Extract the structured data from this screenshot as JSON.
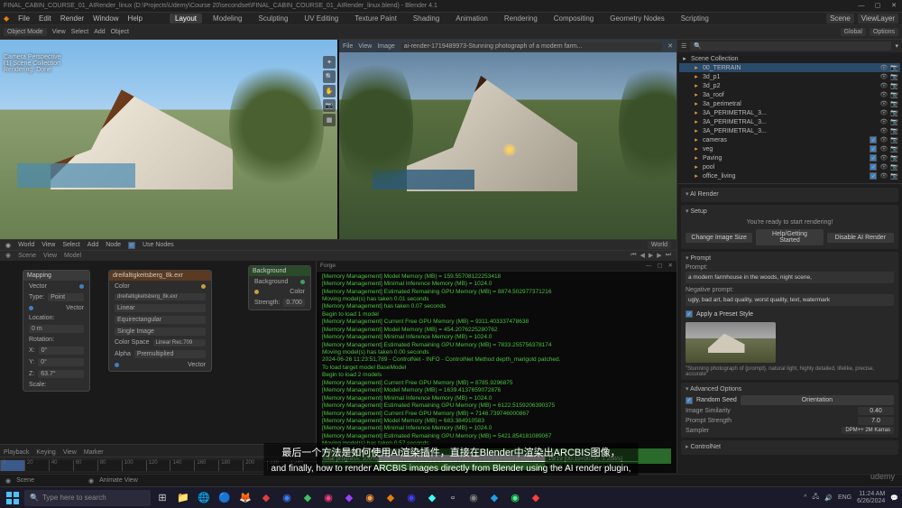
{
  "titlebar": {
    "title": "FINAL_CABIN_COURSE_01_AIRender_linux (D:\\Projects\\Udemy\\Course 20\\secondset\\FINAL_CABIN_COURSE_01_AIRender_linux.blend) - Blender 4.1"
  },
  "menu": {
    "file": "File",
    "edit": "Edit",
    "render": "Render",
    "window": "Window",
    "help": "Help"
  },
  "workspaces": [
    "Layout",
    "Modeling",
    "Sculpting",
    "UV Editing",
    "Texture Paint",
    "Shading",
    "Animation",
    "Rendering",
    "Compositing",
    "Geometry Nodes",
    "Scripting"
  ],
  "active_ws": 0,
  "scene_label": "Scene",
  "viewlayer_label": "ViewLayer",
  "toolbar_left": {
    "mode": "Object Mode",
    "view": "View",
    "select": "Select",
    "add": "Add",
    "object": "Object"
  },
  "toolbar_right": [
    "Global",
    "Options"
  ],
  "viewport1": {
    "info_line1": "Camera Perspective",
    "info_line2": "(1) Scene Collection",
    "info_line3": "Rendering: Done"
  },
  "viewport2_header": {
    "file": "File",
    "view": "View",
    "image": "Image",
    "path": "ai-render-1719489973-Stunning photograph of a modern farm..."
  },
  "status1": {
    "items": [
      "World",
      "View",
      "Select",
      "Add",
      "Node",
      "Use Nodes"
    ],
    "world_label": "World"
  },
  "status2": {
    "items": [
      "Scene",
      "View",
      "Model"
    ]
  },
  "node_editor": {
    "header": {
      "world": "World",
      "view": "View",
      "select": "Select",
      "add": "Add",
      "node": "Node",
      "use_nodes": "Use Nodes"
    }
  },
  "nodes": {
    "mapping": {
      "title": "Mapping",
      "type": "Type:",
      "type_val": "Point",
      "vector": "Vector",
      "loc": "Location:",
      "locv": "0 m",
      "rot": "Rotation:",
      "rotx": "X:",
      "rotxv": "0°",
      "roty": "Y:",
      "rotyv": "0°",
      "rotz": "Z:",
      "rotzv": "63.7°",
      "scale": "Scale:"
    },
    "envtex": {
      "title": "dreifaltigkeitsberg_8k.exr",
      "color": "Color",
      "image": "dreifaltigkeitsberg_8k.exr",
      "linear": "Linear",
      "equirect": "Equirectangular",
      "single": "Single Image",
      "colorspace": "Color Space",
      "cs_val": "Linear Rec.709",
      "alpha": "Alpha",
      "alpha_val": "Premultiplied",
      "vector": "Vector"
    },
    "background": {
      "title": "Background",
      "bg": "Background",
      "color": "Color",
      "strength": "Strength:",
      "strength_val": "0.700"
    }
  },
  "timeline": {
    "playback": "Playback",
    "keying": "Keying",
    "view": "View",
    "marker": "Marker",
    "ticks": [
      "0",
      "20",
      "40",
      "60",
      "80",
      "100",
      "120",
      "140",
      "160",
      "180",
      "200",
      "220",
      "240"
    ]
  },
  "console": {
    "title": "Forge",
    "lines": [
      "[Memory Management] Model Memory (MB) = 159.55708122253418",
      "[Memory Management] Minimal Inference Memory (MB) = 1024.0",
      "[Memory Management] Estimated Remaining GPU Memory (MB) = 8874.502977371216",
      "Moving model(s) has taken 0.01 seconds",
      "[Memory Management] has taken 0.07 seconds",
      "Begin to load 1 model",
      "[Memory Management] Current Free GPU Memory (MB) = 9311.403337478638",
      "[Memory Management] Model Memory (MB) = 454.2076225280762",
      "[Memory Management] Minimal Inference Memory (MB) = 1024.0",
      "[Memory Management] Estimated Remaining GPU Memory (MB) = 7833.255756378174",
      "Moving model(s) has taken 0.00 seconds",
      "2024-06-26 11:23:51,789 - ControlNet - INFO - ControlNet Method depth_marigold patched.",
      "To load target model BaseModel",
      "Begin to load 2 models",
      "[Memory Management] Current Free GPU Memory (MB) = 8785.9296875",
      "[Memory Management] Model Memory (MB) = 1639.4137659072876",
      "[Memory Management] Minimal Inference Memory (MB) = 1024.0",
      "[Memory Management] Estimated Remaining GPU Memory (MB) = 6122.5159206390375",
      "[Memory Management] Current Free GPU Memory (MB) = 7146.739746000867",
      "[Memory Management] Model Memory (MB) = 683.384910583",
      "[Memory Management] Minimal Inference Memory (MB) = 1024.0",
      "[Memory Management] Estimated Remaining GPU Memory (MB) = 5421.854181089067",
      "Moving model(s) has taken 0.57 seconds",
      "Moving model(s) has taken 3.68 seconds",
      "Total progress: 100%|████████████████████████████████████████| 19/19 [00:15<00:00,  1.25it/s]",
      "Total progress: 100%|████████████████████████████████████████| 19/19 [00:15<00:00,  1.21it/s]"
    ]
  },
  "outliner": {
    "title": "Scene Collection",
    "items": [
      {
        "name": "00_TERRAIN",
        "depth": 1,
        "sel": true
      },
      {
        "name": "3d_p1",
        "depth": 1
      },
      {
        "name": "3d_p2",
        "depth": 1
      },
      {
        "name": "3a_roof",
        "depth": 1
      },
      {
        "name": "3a_perimetral",
        "depth": 1
      },
      {
        "name": "3A_PERIMETRAL_3...",
        "depth": 1
      },
      {
        "name": "3A_PERIMETRAL_3...",
        "depth": 1
      },
      {
        "name": "3A_PERIMETRAL_3...",
        "depth": 1
      },
      {
        "name": "cameras",
        "depth": 1
      },
      {
        "name": "veg",
        "depth": 1
      },
      {
        "name": "Paving",
        "depth": 1
      },
      {
        "name": "pool",
        "depth": 1
      },
      {
        "name": "office_living",
        "depth": 1
      }
    ]
  },
  "ai_panel": {
    "title": "AI Render",
    "setup": "Setup",
    "ready_msg": "You're ready to start rendering!",
    "btn_change": "Change Image Size",
    "btn_help": "Help/Getting Started",
    "btn_disable": "Disable AI Render",
    "prompt_section": "Prompt",
    "prompt_label": "Prompt:",
    "prompt_text": "a modern farmhouse in the woods, night scene,",
    "neg_label": "Negative prompt:",
    "neg_text": "ugly, bad art, bad quality, worst quality, text, watermark",
    "preset_check": "Apply a Preset Style",
    "preset_caption": "\"Stunning photograph of {prompt}, natural light, highly detailed, lifelike, precise, accurate\"",
    "adv": "Advanced Options",
    "seed_check": "Random Seed",
    "orientation": "Orientation",
    "similarity": "Image Similarity",
    "similarity_val": "0.40",
    "prompt_str": "Prompt Strength",
    "prompt_str_val": "7.0",
    "sampler": "Sampler",
    "sampler_val": "DPM++ 2M Karras",
    "controlnet": "ControlNet"
  },
  "subtitle": {
    "cn": "最后一个方法是如何使用AI渲染插件，直接在Blender中渲染出ARCBIS图像，",
    "en": "and finally, how to render ARCBIS images directly from Blender using the AI render plugin,"
  },
  "footer": {
    "scene": "Scene",
    "layer": "Animate View"
  },
  "taskbar": {
    "search_placeholder": "Type here to search",
    "tray": {
      "lang": "ENG",
      "time": "11:24 AM",
      "date": "6/26/2024"
    }
  },
  "watermark": "udemy"
}
